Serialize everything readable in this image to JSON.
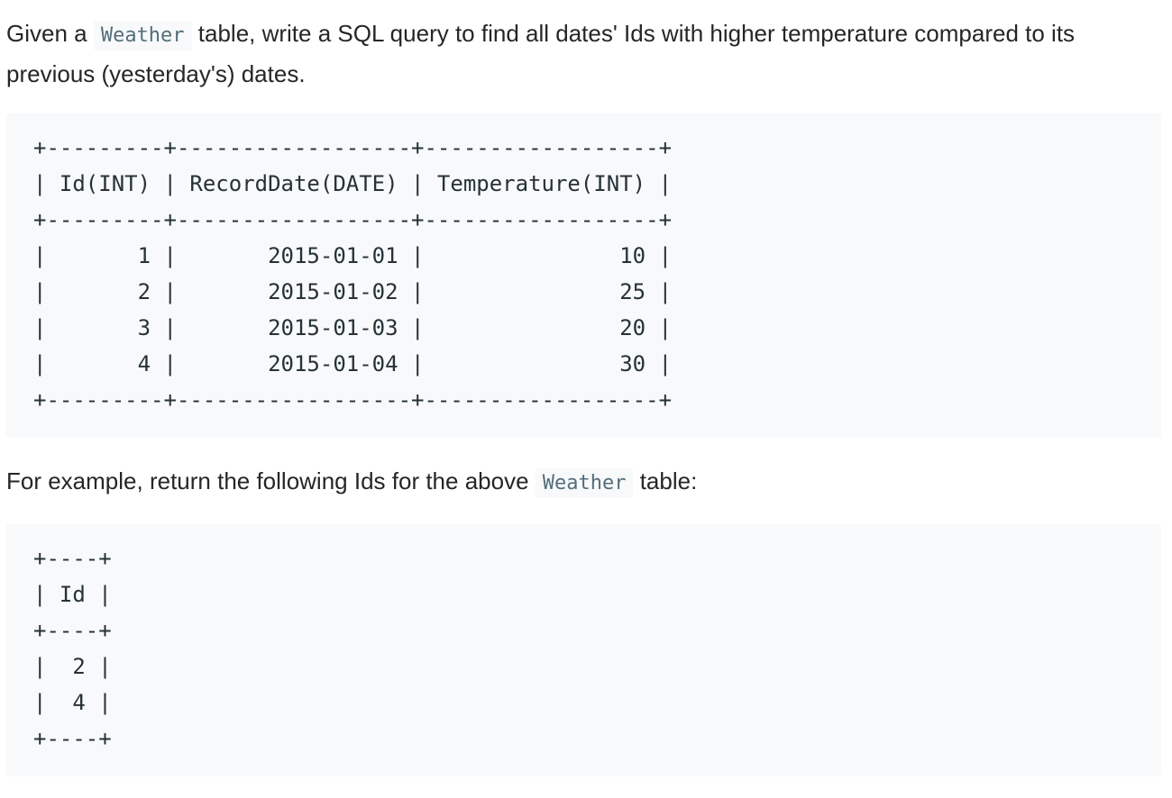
{
  "intro": {
    "text_before": "Given a ",
    "code": "Weather",
    "text_after": " table, write a SQL query to find all dates' Ids with higher temperature compared to its previous (yesterday's) dates."
  },
  "weather_table": {
    "ascii": "+---------+------------------+------------------+\n| Id(INT) | RecordDate(DATE) | Temperature(INT) |\n+---------+------------------+------------------+\n|       1 |       2015-01-01 |               10 |\n|       2 |       2015-01-02 |               25 |\n|       3 |       2015-01-03 |               20 |\n|       4 |       2015-01-04 |               30 |\n+---------+------------------+------------------+",
    "columns": [
      "Id(INT)",
      "RecordDate(DATE)",
      "Temperature(INT)"
    ],
    "rows": [
      [
        1,
        "2015-01-01",
        10
      ],
      [
        2,
        "2015-01-02",
        25
      ],
      [
        3,
        "2015-01-03",
        20
      ],
      [
        4,
        "2015-01-04",
        30
      ]
    ]
  },
  "example": {
    "text_before": "For example, return the following Ids for the above ",
    "code": "Weather",
    "text_after": " table:"
  },
  "result_table": {
    "ascii": "+----+\n| Id |\n+----+\n|  2 |\n|  4 |\n+----+",
    "columns": [
      "Id"
    ],
    "rows": [
      [
        2
      ],
      [
        4
      ]
    ]
  }
}
